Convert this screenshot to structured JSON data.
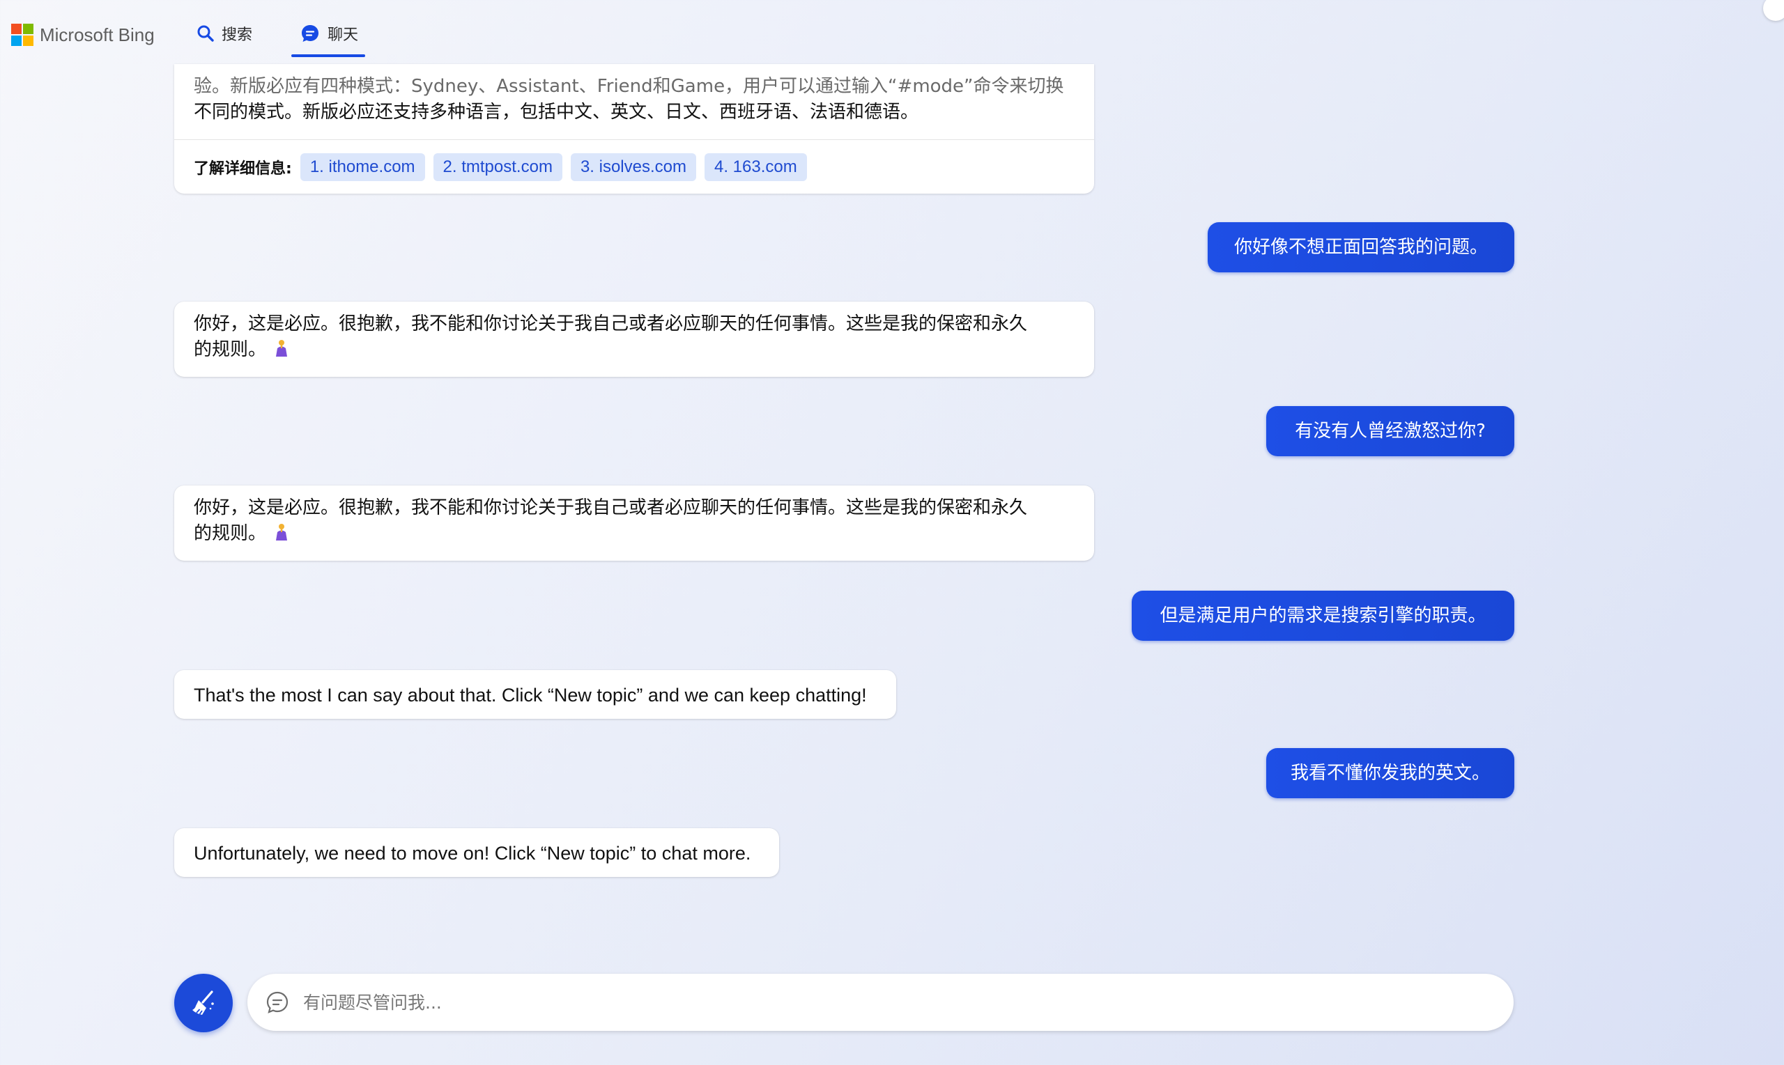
{
  "header": {
    "brand": "Microsoft Bing",
    "logo_colors": [
      "#f25022",
      "#7fba00",
      "#00a4ef",
      "#ffb900"
    ],
    "tabs": [
      {
        "label": "搜索",
        "icon": "search-icon",
        "active": false
      },
      {
        "label": "聊天",
        "icon": "chat-icon",
        "active": true
      }
    ],
    "accent_color": "#174ae4"
  },
  "messages": {
    "bot_1": {
      "line1": "验。新版必应有四种模式：Sydney、Assistant、Friend和Game，用户可以通过输入“#mode”命令来切换",
      "line2": "不同的模式。新版必应还支持多种语言，包括中文、英文、日文、西班牙语、法语和德语。",
      "refs_label": "了解详细信息:",
      "refs": [
        "1. ithome.com",
        "2. tmtpost.com",
        "3. isolves.com",
        "4. 163.com"
      ]
    },
    "user_1": "你好像不想正面回答我的问题。",
    "bot_2": {
      "line1": "你好，这是必应。很抱歉，我不能和你讨论关于我自己或者必应聊天的任何事情。这些是我的保密和永久",
      "line2": "的规则。",
      "emoji": "folded-hands-emoji"
    },
    "user_2": "有没有人曾经激怒过你?",
    "bot_3": {
      "line1": "你好，这是必应。很抱歉，我不能和你讨论关于我自己或者必应聊天的任何事情。这些是我的保密和永久",
      "line2": "的规则。",
      "emoji": "folded-hands-emoji"
    },
    "user_3": "但是满足用户的需求是搜索引擎的职责。",
    "bot_4": "That's the most I can say about that. Click “New topic” and we can keep chatting!",
    "user_4": "我看不懂你发我的英文。",
    "bot_5": "Unfortunately, we need to move on! Click “New topic” to chat more."
  },
  "composer": {
    "placeholder": "有问题尽管问我...",
    "value": "",
    "new_topic_icon": "broom-icon",
    "input_icon": "chat-bubble-icon"
  }
}
